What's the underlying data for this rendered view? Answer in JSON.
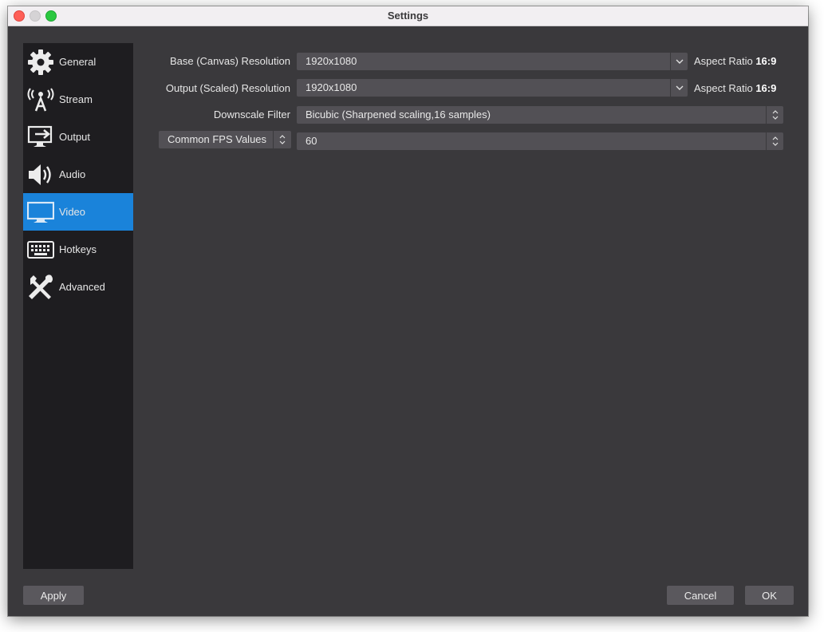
{
  "window": {
    "title": "Settings"
  },
  "sidebar": {
    "items": [
      {
        "label": "General",
        "icon": "gear-icon",
        "active": false
      },
      {
        "label": "Stream",
        "icon": "broadcast-antenna-icon",
        "active": false
      },
      {
        "label": "Output",
        "icon": "output-monitor-icon",
        "active": false
      },
      {
        "label": "Audio",
        "icon": "speaker-icon",
        "active": false
      },
      {
        "label": "Video",
        "icon": "monitor-icon",
        "active": true
      },
      {
        "label": "Hotkeys",
        "icon": "keyboard-icon",
        "active": false
      },
      {
        "label": "Advanced",
        "icon": "wrench-screwdriver-icon",
        "active": false
      }
    ]
  },
  "video": {
    "base_resolution": {
      "label": "Base (Canvas) Resolution",
      "value": "1920x1080",
      "aspect_prefix": "Aspect Ratio",
      "aspect_value": "16:9"
    },
    "output_resolution": {
      "label": "Output (Scaled) Resolution",
      "value": "1920x1080",
      "aspect_prefix": "Aspect Ratio",
      "aspect_value": "16:9"
    },
    "downscale_filter": {
      "label": "Downscale Filter",
      "value": "Bicubic (Sharpened scaling,16 samples)"
    },
    "fps": {
      "type_label": "Common FPS Values",
      "value": "60"
    }
  },
  "buttons": {
    "apply": "Apply",
    "cancel": "Cancel",
    "ok": "OK"
  },
  "colors": {
    "accent": "#1a83da",
    "window_bg": "#3a393c",
    "sidebar_bg": "#1e1d20",
    "field_bg": "#525055"
  }
}
